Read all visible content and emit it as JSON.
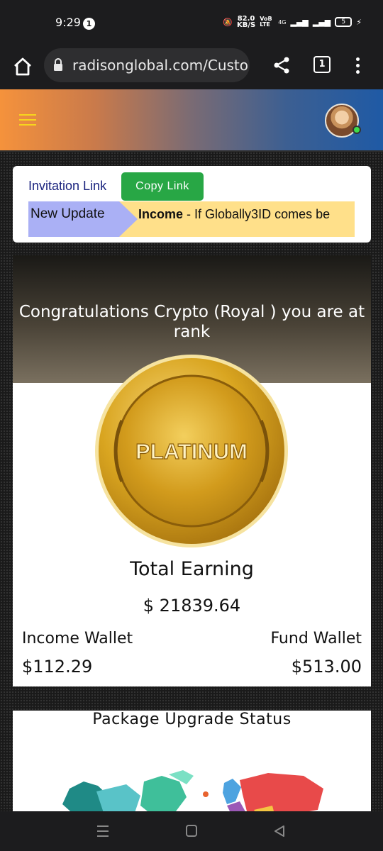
{
  "status_bar": {
    "time": "9:29",
    "notification_count": "1",
    "speed_value": "82.0",
    "speed_unit": "KB/S",
    "network_tag": "VoB LTE",
    "network_type": "4G",
    "battery": "5"
  },
  "browser": {
    "url": "radisonglobal.com/Custo",
    "tab_count": "1"
  },
  "invite": {
    "label": "Invitation Link",
    "copy_button": "Copy Link",
    "update_label": "New Update",
    "update_bold": "Income",
    "update_text": " - If Globally3ID comes be"
  },
  "rank": {
    "message": "Congratulations Crypto (Royal ) you are at rank",
    "badge": "PLATINUM",
    "total_label": "Total Earning",
    "total_value": "$ 21839.64",
    "income_wallet_label": "Income Wallet",
    "income_wallet_value": "$112.29",
    "fund_wallet_label": "Fund Wallet",
    "fund_wallet_value": "$513.00"
  },
  "package": {
    "title": "Package Upgrade Status"
  },
  "colors": {
    "copy_button": "#28a745",
    "invite_label": "#1a237e",
    "update_label_bg": "#aab0f5",
    "update_bar_bg": "#ffe08a",
    "hamburger": "#f7d51d",
    "coin_gold": "#d9a520"
  },
  "icons": [
    "home-icon",
    "lock-icon",
    "share-icon",
    "tabs-icon",
    "more-vert-icon",
    "hamburger-icon",
    "avatar",
    "recent-apps-icon",
    "nav-home-icon",
    "back-icon"
  ]
}
